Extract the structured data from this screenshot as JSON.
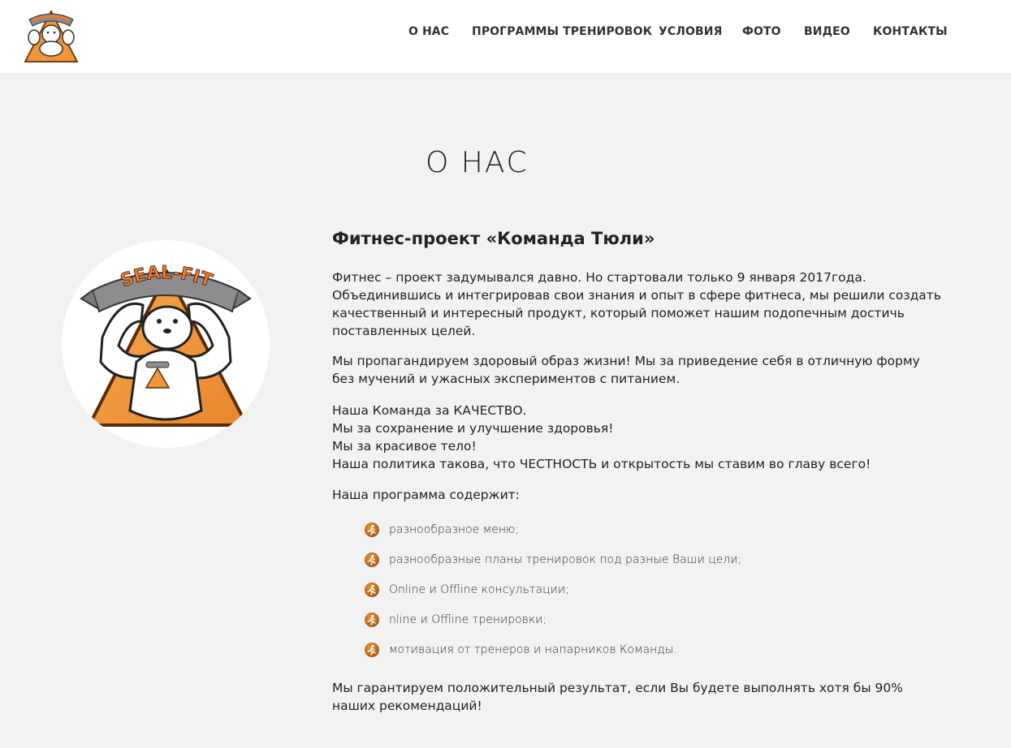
{
  "brand": {
    "logo_alt": "SEAL-FIT"
  },
  "nav": {
    "items": [
      "О НАС",
      "ПРОГРАММЫ ТРЕНИРОВОК",
      "УСЛОВИЯ",
      "ФОТО",
      "ВИДЕО",
      "КОНТАКТЫ"
    ]
  },
  "about": {
    "title": "О НАС",
    "subtitle": "Фитнес-проект «Команда Тюли»",
    "image_banner": "SEAL-FIT",
    "p1": [
      "Фитнес – проект задумывался давно. Но стартовали только 9 января 2017года.",
      "Объединившись и интегрировав свои знания и опыт в сфере фитнеса, мы решили создать",
      "качественный и интересный продукт, который поможет нашим подопечным достичь",
      "поставленных целей."
    ],
    "p2": [
      "Мы пропагандируем здоровый образ жизни! Мы за приведение себя в отличную форму",
      "без мучений и ужасных экспериментов с питанием."
    ],
    "p3": [
      "Наша Команда за КАЧЕСТВО.",
      "Мы за сохранение и улучшение здоровья!",
      "Мы за красивое тело!",
      "Наша политика такова, что ЧЕСТНОСТЬ и открытость мы ставим во главу всего!"
    ],
    "p4": "Наша программа содержит:",
    "list": [
      "разнообразное меню;",
      "разнообразные планы тренировок под разные Ваши цели;",
      "Online и Offline консультации;",
      "nline и Offline тренировки;",
      "мотивация от тренеров и напарников Команды."
    ],
    "p5": [
      "Мы гарантируем положительный результат, если Вы будете выполнять хотя бы 90%",
      "наших рекомендаций!"
    ]
  },
  "colors": {
    "accent": "#f0963a",
    "header_bg": "#ffffff",
    "page_bg": "#f2f2f2"
  }
}
